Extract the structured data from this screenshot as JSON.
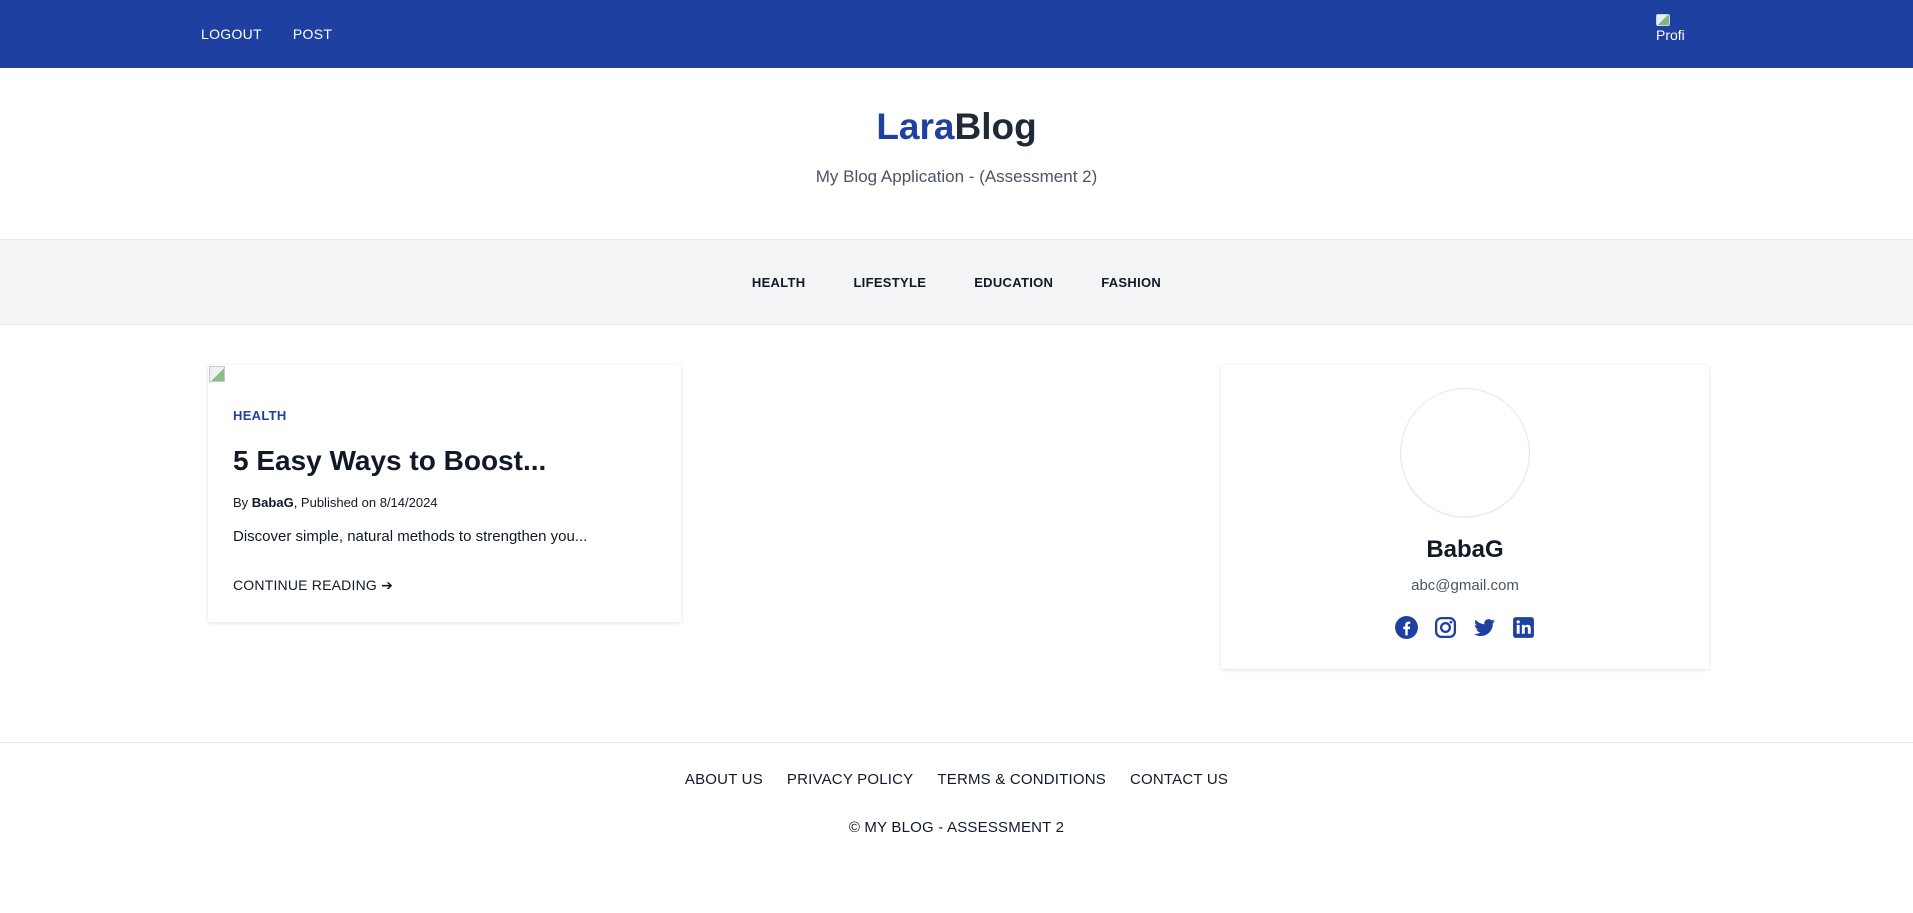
{
  "topbar": {
    "nav": [
      {
        "label": "LOGOUT"
      },
      {
        "label": "POST"
      }
    ],
    "profile_alt": "Profi"
  },
  "masthead": {
    "brand_part1": "Lara",
    "brand_part2": "Blog",
    "tagline": "My Blog Application - (Assessment 2)"
  },
  "categories": [
    {
      "label": "HEALTH"
    },
    {
      "label": "LIFESTYLE"
    },
    {
      "label": "EDUCATION"
    },
    {
      "label": "FASHION"
    }
  ],
  "post": {
    "category": "HEALTH",
    "title": "5 Easy Ways to Boost...",
    "by_prefix": "By",
    "author": "BabaG",
    "published": ", Published on 8/14/2024",
    "excerpt": "Discover simple, natural methods to strengthen you...",
    "continue_label": "CONTINUE READING",
    "continue_arrow": "➔"
  },
  "profile": {
    "name": "BabaG",
    "email": "abc@gmail.com",
    "socials": [
      {
        "icon": "facebook-icon"
      },
      {
        "icon": "instagram-icon"
      },
      {
        "icon": "twitter-icon"
      },
      {
        "icon": "linkedin-icon"
      }
    ],
    "social_color": "#1e40a0"
  },
  "footer": {
    "links": [
      {
        "label": "ABOUT US"
      },
      {
        "label": "PRIVACY POLICY"
      },
      {
        "label": "TERMS & CONDITIONS"
      },
      {
        "label": "CONTACT US"
      }
    ],
    "copyright": "© MY BLOG - ASSESSMENT 2"
  },
  "colors": {
    "primary": "#1e40a0",
    "catbar_bg": "#f3f4f6"
  }
}
